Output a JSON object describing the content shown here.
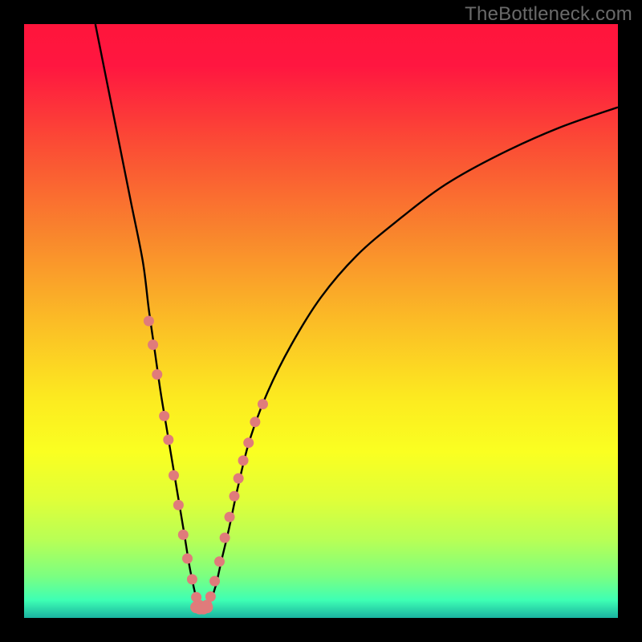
{
  "watermark": "TheBottleneck.com",
  "gradient": {
    "stops": [
      {
        "offset": 0.0,
        "color": "#ff153b"
      },
      {
        "offset": 0.07,
        "color": "#ff1640"
      },
      {
        "offset": 0.2,
        "color": "#fb4b35"
      },
      {
        "offset": 0.35,
        "color": "#f9842d"
      },
      {
        "offset": 0.5,
        "color": "#fbbc26"
      },
      {
        "offset": 0.63,
        "color": "#fcea20"
      },
      {
        "offset": 0.72,
        "color": "#faff21"
      },
      {
        "offset": 0.8,
        "color": "#e0ff38"
      },
      {
        "offset": 0.87,
        "color": "#b7ff56"
      },
      {
        "offset": 0.93,
        "color": "#7bff81"
      },
      {
        "offset": 0.97,
        "color": "#3effb4"
      },
      {
        "offset": 1.0,
        "color": "#1ab3a0"
      }
    ]
  },
  "chart_data": {
    "type": "line",
    "title": "",
    "xlabel": "",
    "ylabel": "",
    "xlim": [
      0,
      100
    ],
    "ylim": [
      0,
      100
    ],
    "series": [
      {
        "name": "left-branch",
        "x": [
          12,
          14,
          16,
          18,
          20,
          21,
          22,
          23,
          24,
          25,
          26,
          27,
          27.8,
          28.5,
          29,
          29.4,
          29.8,
          30.2
        ],
        "y": [
          100,
          90,
          80,
          70,
          60,
          52,
          45,
          38,
          32,
          26,
          20,
          14,
          9,
          5.5,
          3.3,
          2.2,
          1.8,
          1.6
        ]
      },
      {
        "name": "right-branch",
        "x": [
          30.2,
          30.8,
          31.5,
          32.3,
          33.2,
          34.5,
          36,
          38,
          41,
          45,
          50,
          56,
          63,
          71,
          80,
          90,
          100
        ],
        "y": [
          1.6,
          2.0,
          3.2,
          5.5,
          9.5,
          15,
          22,
          30,
          38,
          46,
          54,
          61,
          67,
          73,
          78,
          82.5,
          86
        ]
      }
    ],
    "markers": {
      "left": [
        {
          "x": 21.0,
          "y": 50
        },
        {
          "x": 21.7,
          "y": 46
        },
        {
          "x": 22.4,
          "y": 41
        },
        {
          "x": 23.6,
          "y": 34
        },
        {
          "x": 24.3,
          "y": 30
        },
        {
          "x": 25.2,
          "y": 24
        },
        {
          "x": 26.0,
          "y": 19
        },
        {
          "x": 26.8,
          "y": 14
        },
        {
          "x": 27.5,
          "y": 10
        },
        {
          "x": 28.3,
          "y": 6.5
        },
        {
          "x": 29.0,
          "y": 3.5
        },
        {
          "x": 29.5,
          "y": 2.2
        }
      ],
      "right": [
        {
          "x": 30.8,
          "y": 2.2
        },
        {
          "x": 31.4,
          "y": 3.6
        },
        {
          "x": 32.1,
          "y": 6.2
        },
        {
          "x": 32.9,
          "y": 9.5
        },
        {
          "x": 33.8,
          "y": 13.5
        },
        {
          "x": 34.6,
          "y": 17
        },
        {
          "x": 35.4,
          "y": 20.5
        },
        {
          "x": 36.1,
          "y": 23.5
        },
        {
          "x": 36.9,
          "y": 26.5
        },
        {
          "x": 37.8,
          "y": 29.5
        },
        {
          "x": 38.9,
          "y": 33
        },
        {
          "x": 40.2,
          "y": 36
        }
      ],
      "bottom": [
        {
          "x": 29.0,
          "y": 1.8
        },
        {
          "x": 29.6,
          "y": 1.6
        },
        {
          "x": 30.2,
          "y": 1.6
        },
        {
          "x": 30.8,
          "y": 1.8
        }
      ]
    },
    "marker_color": "#e07b7b",
    "curve_color": "#000000"
  }
}
